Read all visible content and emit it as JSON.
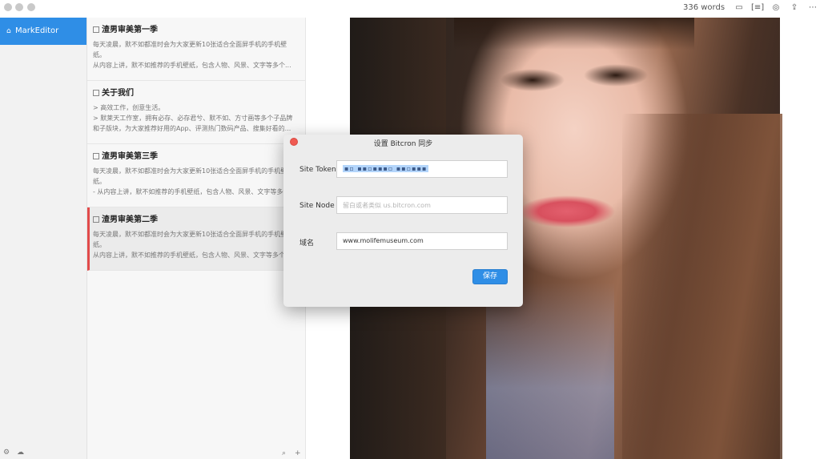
{
  "titlebar": {
    "word_count": "336 words",
    "icons": [
      "folder-icon",
      "code-icon",
      "preview-icon",
      "share-icon",
      "more-icon"
    ]
  },
  "sidebar": {
    "brand": "MarkEditor",
    "brand_icon": "home-icon",
    "bottom_icons": [
      "settings-icon",
      "sync-icon"
    ]
  },
  "notes": [
    {
      "title": "渣男审美第一季",
      "lines": [
        "每天凌晨，默不如都准时会为大家更新10张适合全面屏手机的手机壁",
        "纸。",
        "从内容上讲，默不如推荐的手机壁纸，包含人物、风景、文字等多个..."
      ]
    },
    {
      "title": "关于我们",
      "lines": [
        "> 高效工作，创意生活。",
        "> 默莱天工作室，拥有必存、必存君兮、默不如、方寸画等多个子品牌",
        "和子版块，为大家推荐好用的App、评测热门数码产品、搜集好看的..."
      ]
    },
    {
      "title": "渣男审美第三季",
      "lines": [
        "每天凌晨，默不如都准时会为大家更新10张适合全面屏手机的手机壁",
        "纸。",
        "- 从内容上讲，默不如推荐的手机壁纸，包含人物、风景、文字等多个..."
      ]
    },
    {
      "title": "渣男审美第二季",
      "lines": [
        "每天凌晨，默不如都准时会为大家更新10张适合全面屏手机的手机壁",
        "纸。",
        "从内容上讲，默不如推荐的手机壁纸，包含人物、风景、文字等多个..."
      ],
      "active": true
    }
  ],
  "notes_footer": {
    "search": "⌕",
    "add": "+"
  },
  "dialog": {
    "title": "设置 Bitcron 同步",
    "site_token_label": "Site Token",
    "site_token_value": "▪▫ ▪▪▫▪▪▪▫ ▪▪▫▪▪▪",
    "site_node_label": "Site Node",
    "site_node_placeholder": "留白或者类似 us.bitcron.com",
    "domain_label": "域名",
    "domain_value": "www.molifemuseum.com",
    "save_label": "保存"
  },
  "colors": {
    "accent": "#2f8ee6",
    "active_marker": "#e24b4b",
    "close_button": "#f05a52"
  }
}
